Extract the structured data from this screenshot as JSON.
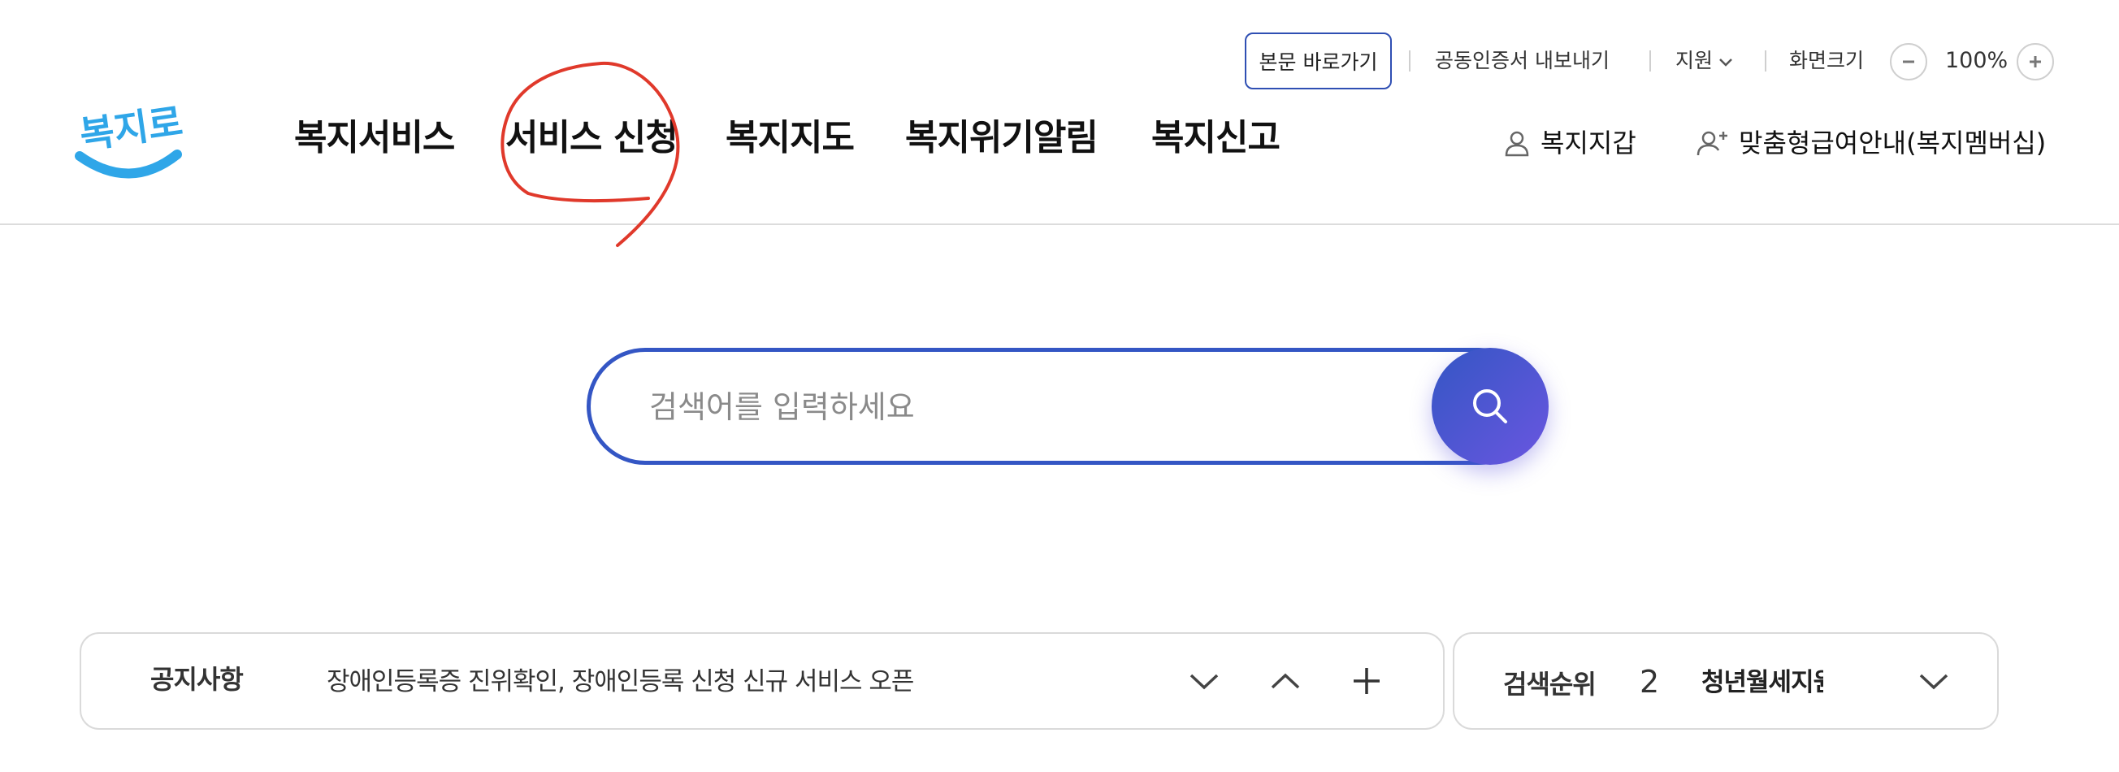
{
  "utility": {
    "skip_to_content": "본문 바로가기",
    "cert_export": "공동인증서 내보내기",
    "support": "지원",
    "screen_size": "화면크기",
    "zoom_level": "100%"
  },
  "logo": {
    "text": "복지로"
  },
  "nav": {
    "items": [
      {
        "label": "복지서비스"
      },
      {
        "label": "서비스 신청"
      },
      {
        "label": "복지지도"
      },
      {
        "label": "복지위기알림"
      },
      {
        "label": "복지신고"
      }
    ]
  },
  "right_nav": {
    "wallet": "복지지갑",
    "membership": "맞춤형급여안내(복지멤버십)"
  },
  "search": {
    "placeholder": "검색어를 입력하세요",
    "value": ""
  },
  "notice": {
    "label": "공지사항",
    "text": "장애인등록증 진위확인, 장애인등록 신청 신규 서비스 오픈"
  },
  "ranking": {
    "label": "검색순위",
    "number": "2",
    "text": "청년월세지원"
  },
  "colors": {
    "accent": "#3456c4",
    "annotation": "#e0392b",
    "logo_blue": "#2fa6e8"
  }
}
